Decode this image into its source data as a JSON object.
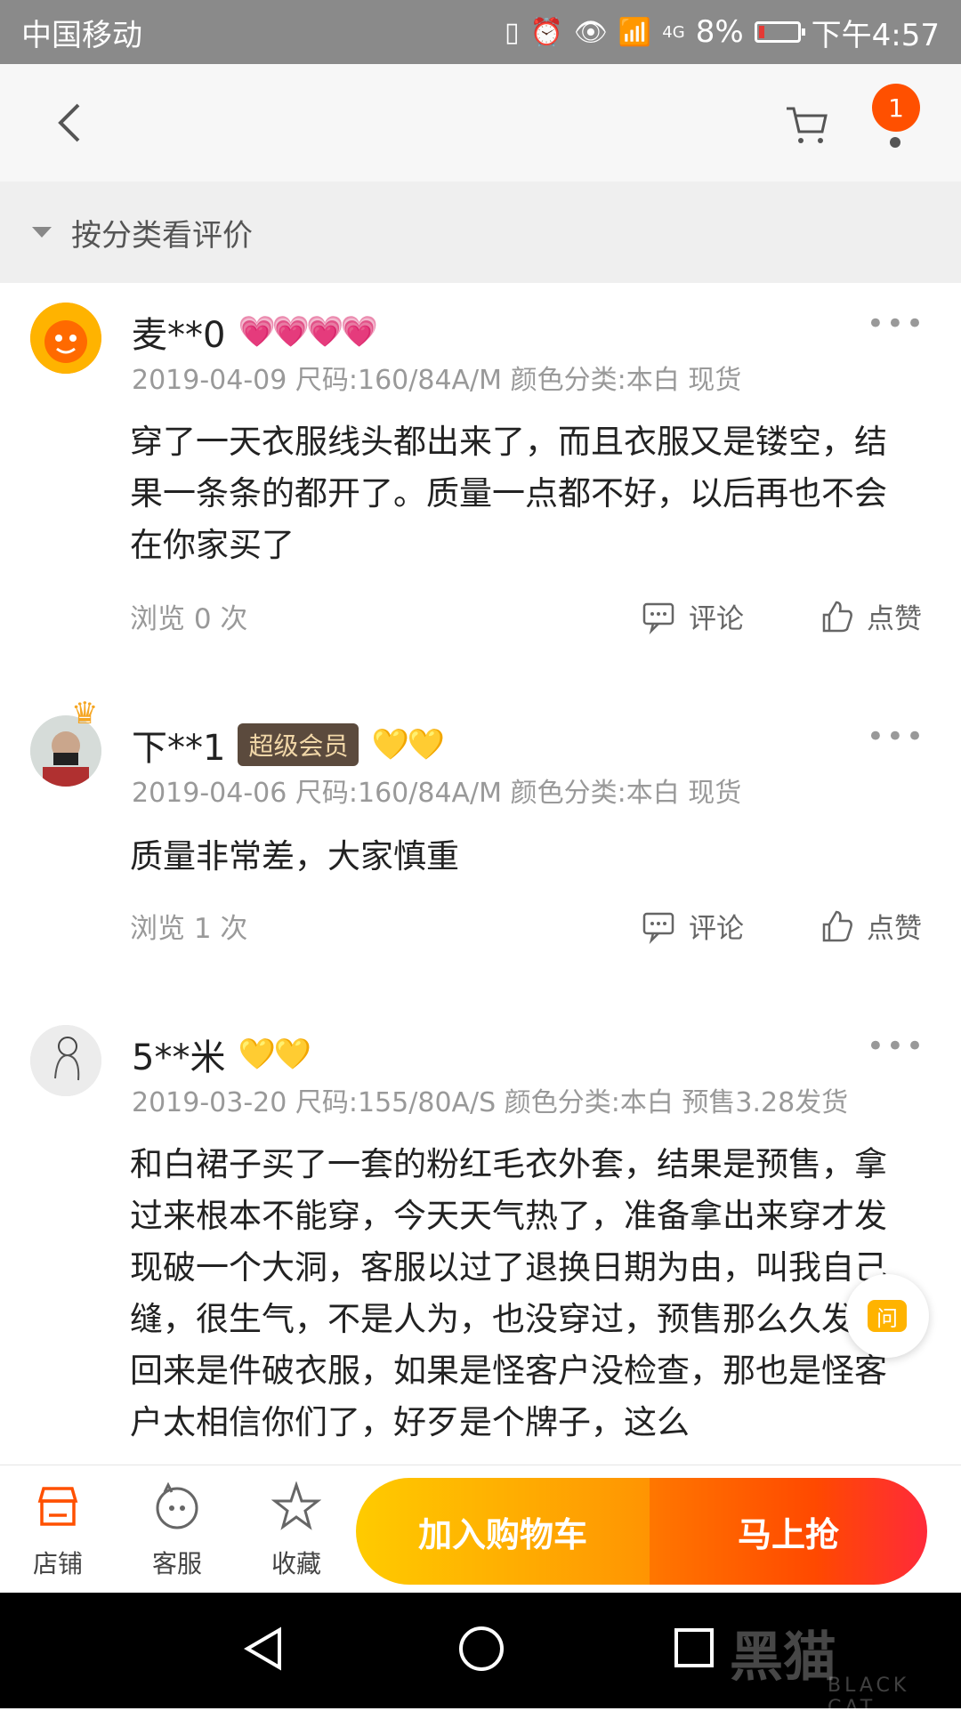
{
  "status_bar": {
    "carrier": "中国移动",
    "network": "4G",
    "battery": "8%",
    "time": "下午4:57",
    "battery_color": "#e53935"
  },
  "nav": {
    "cart_badge": "1",
    "icons": [
      "back-arrow-icon",
      "cart-icon"
    ]
  },
  "filter": {
    "label": "按分类看评价"
  },
  "reviews": [
    {
      "user": "麦**0",
      "badge": "",
      "rank": "💗💗💗💗",
      "meta": "2019-04-09 尺码:160/84A/M 颜色分类:本白 现货",
      "content": "穿了一天衣服线头都出来了，而且衣服又是镂空，结果一条条的都开了。质量一点都不好，以后再也不会在你家买了",
      "views": "浏览 0 次",
      "comment": "评论",
      "like": "点赞"
    },
    {
      "user": "下**1",
      "badge": "超级会员",
      "rank": "💛💛",
      "meta": "2019-04-06 尺码:160/84A/M 颜色分类:本白 现货",
      "content": "质量非常差，大家慎重",
      "views": "浏览 1 次",
      "comment": "评论",
      "like": "点赞"
    },
    {
      "user": "5**米",
      "badge": "",
      "rank": "💛💛",
      "meta": "2019-03-20 尺码:155/80A/S 颜色分类:本白 预售3.28发货",
      "content": "和白裙子买了一套的粉红毛衣外套，结果是预售，拿过来根本不能穿，今天天气热了，准备拿出来穿才发现破一个大洞，客服以过了退换日期为由，叫我自己缝，很生气，不是人为，也没穿过，预售那么久发现回来是件破衣服，如果是怪客户没检查，那也是怪客户太相信你们了，好歹是个牌子，这么"
    }
  ],
  "ask_button": {
    "label": "问"
  },
  "bottom": {
    "shop": "店铺",
    "service": "客服",
    "favorite": "收藏",
    "add_cart": "加入购物车",
    "buy_now": "马上抢",
    "accent": "#ff5000"
  },
  "watermark": {
    "main": "黑猫",
    "sub": "BLACK CAT"
  }
}
